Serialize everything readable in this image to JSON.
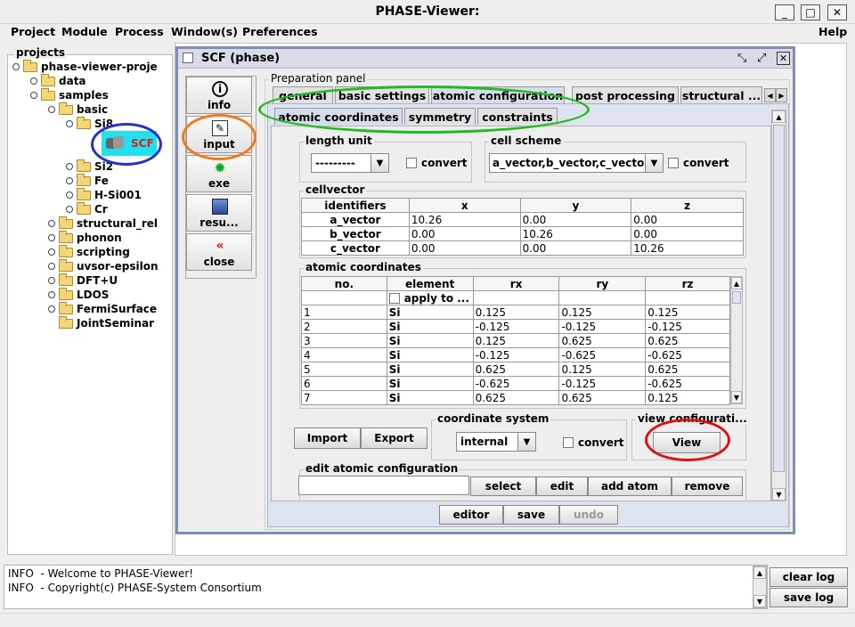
{
  "window": {
    "title": "PHASE-Viewer:",
    "min": "_",
    "max": "□",
    "close": "✕"
  },
  "menu": [
    "Project",
    "Module",
    "Process",
    "Window(s)",
    "Preferences",
    "Help"
  ],
  "tree": {
    "title": "projects",
    "items": [
      {
        "label": "phase-viewer-proje"
      },
      {
        "label": "data"
      },
      {
        "label": "samples"
      },
      {
        "label": "basic"
      },
      {
        "label": "Si8"
      },
      {
        "label": "SCF"
      },
      {
        "label": "Si2"
      },
      {
        "label": "Fe"
      },
      {
        "label": "H-Si001"
      },
      {
        "label": "Cr"
      },
      {
        "label": "structural_rel"
      },
      {
        "label": "phonon"
      },
      {
        "label": "scripting"
      },
      {
        "label": "uvsor-epsilon"
      },
      {
        "label": "DFT+U"
      },
      {
        "label": "LDOS"
      },
      {
        "label": "FermiSurface"
      },
      {
        "label": "JointSeminar"
      }
    ]
  },
  "frame": {
    "title": "SCF (phase)",
    "side_buttons": [
      {
        "label": "info",
        "icon": "info-icon"
      },
      {
        "label": "input",
        "icon": "edit-icon"
      },
      {
        "label": "exe",
        "icon": "gear-icon"
      },
      {
        "label": "resu...",
        "icon": "chart-icon"
      },
      {
        "label": "close",
        "icon": "close-icon"
      }
    ],
    "panel_label": "Preparation panel",
    "tabs": [
      "general",
      "basic settings",
      "atomic configuration",
      "post processing",
      "structural ..."
    ],
    "subtabs": [
      "atomic coordinates",
      "symmetry",
      "constraints"
    ],
    "length_unit": {
      "legend": "length unit",
      "value": "---------",
      "convert": "convert"
    },
    "cell_scheme": {
      "legend": "cell scheme",
      "value": "a_vector,b_vector,c_vector",
      "convert": "convert"
    },
    "cellvector": {
      "legend": "cellvector",
      "headers": [
        "identifiers",
        "x",
        "y",
        "z"
      ],
      "rows": [
        [
          "a_vector",
          "10.26",
          "0.00",
          "0.00"
        ],
        [
          "b_vector",
          "0.00",
          "10.26",
          "0.00"
        ],
        [
          "c_vector",
          "0.00",
          "0.00",
          "10.26"
        ]
      ]
    },
    "atomic_coordinates": {
      "legend": "atomic coordinates",
      "headers": [
        "no.",
        "element",
        "rx",
        "ry",
        "rz"
      ],
      "apply_label": "apply to ...",
      "rows": [
        [
          "1",
          "Si",
          "0.125",
          "0.125",
          "0.125"
        ],
        [
          "2",
          "Si",
          "-0.125",
          "-0.125",
          "-0.125"
        ],
        [
          "3",
          "Si",
          "0.125",
          "0.625",
          "0.625"
        ],
        [
          "4",
          "Si",
          "-0.125",
          "-0.625",
          "-0.625"
        ],
        [
          "5",
          "Si",
          "0.625",
          "0.125",
          "0.625"
        ],
        [
          "6",
          "Si",
          "-0.625",
          "-0.125",
          "-0.625"
        ],
        [
          "7",
          "Si",
          "0.625",
          "0.625",
          "0.125"
        ]
      ]
    },
    "import_label": "Import",
    "export_label": "Export",
    "coordinate_system": {
      "legend": "coordinate system",
      "value": "internal",
      "convert": "convert"
    },
    "view_config": {
      "legend": "view configurati...",
      "button": "View"
    },
    "edit_config": {
      "legend": "edit atomic configuration",
      "input_value": "",
      "buttons": [
        "select",
        "edit",
        "add atom",
        "remove"
      ]
    },
    "bottom_buttons": [
      "editor",
      "save",
      "undo"
    ]
  },
  "log": {
    "lines": [
      "INFO  - Welcome to PHASE-Viewer!",
      "INFO  - Copyright(c) PHASE-System Consortium"
    ],
    "clear": "clear log",
    "save": "save log"
  },
  "colors": {
    "highlight_green": "#22bb22",
    "highlight_orange": "#f07a1e",
    "highlight_blue": "#2233cc",
    "highlight_red": "#dd1111",
    "scf_selection": "#22e0ee",
    "frame_border": "#7c8fb8"
  }
}
